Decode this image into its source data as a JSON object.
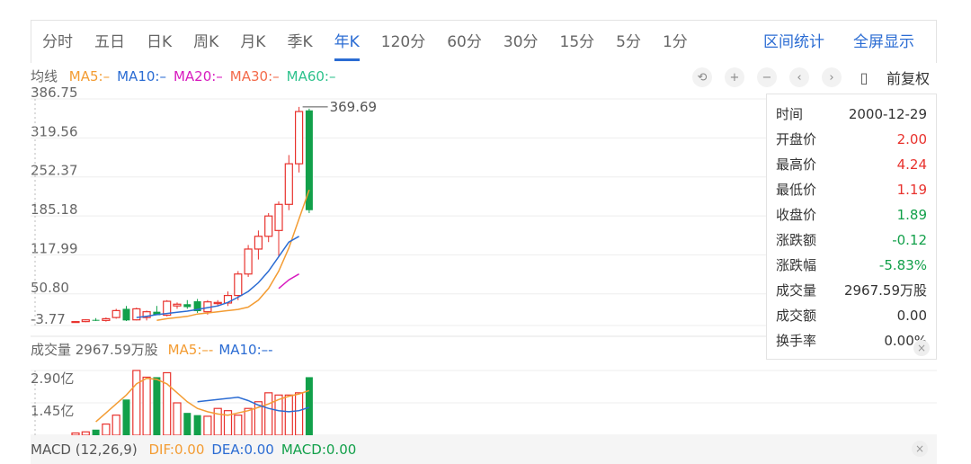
{
  "tabs": [
    "分时",
    "五日",
    "日K",
    "周K",
    "月K",
    "季K",
    "年K",
    "120分",
    "60分",
    "30分",
    "15分",
    "5分",
    "1分"
  ],
  "active_tab": "年K",
  "tab_actions": {
    "range_stats": "区间统计",
    "fullscreen": "全屏显示"
  },
  "ma_legend": {
    "title": "均线",
    "items": [
      {
        "label": "MA5:–",
        "color": "#f39c33"
      },
      {
        "label": "MA10:–",
        "color": "#2b6cd3"
      },
      {
        "label": "MA20:–",
        "color": "#d81bbf"
      },
      {
        "label": "MA30:–",
        "color": "#f36a4a"
      },
      {
        "label": "MA60:–",
        "color": "#2ec28d"
      }
    ]
  },
  "toolbar": {
    "icons": [
      "undo-icon",
      "zoom-in-icon",
      "zoom-out-icon",
      "chevron-left-icon",
      "chevron-right-icon",
      "candlestick-icon"
    ],
    "adjust_label": "前复权"
  },
  "info_panel": {
    "rows": [
      {
        "label": "时间",
        "value": "2000-12-29",
        "color": "#333333"
      },
      {
        "label": "开盘价",
        "value": "2.00",
        "color": "#e8322d"
      },
      {
        "label": "最高价",
        "value": "4.24",
        "color": "#e8322d"
      },
      {
        "label": "最低价",
        "value": "1.19",
        "color": "#e8322d"
      },
      {
        "label": "收盘价",
        "value": "1.89",
        "color": "#12a04a"
      },
      {
        "label": "涨跌额",
        "value": "-0.12",
        "color": "#12a04a"
      },
      {
        "label": "涨跌幅",
        "value": "-5.83%",
        "color": "#12a04a"
      },
      {
        "label": "成交量",
        "value": "2967.59万股",
        "color": "#333333"
      },
      {
        "label": "成交额",
        "value": "0.00",
        "color": "#333333"
      },
      {
        "label": "换手率",
        "value": "0.00%",
        "color": "#333333"
      }
    ]
  },
  "volume_legend": {
    "title": "成交量 2967.59万股",
    "items": [
      {
        "label": "MA5:–-",
        "color": "#f39c33"
      },
      {
        "label": "MA10:–-",
        "color": "#2b6cd3"
      }
    ]
  },
  "macd_legend": {
    "title": "MACD (12,26,9)",
    "items": [
      {
        "label": "DIF:0.00",
        "color": "#f39c33"
      },
      {
        "label": "DEA:0.00",
        "color": "#2b6cd3"
      },
      {
        "label": "MACD:0.00",
        "color": "#12a04a"
      }
    ]
  },
  "colors": {
    "up": "#e8322d",
    "down": "#12a04a",
    "grid": "#eeeeee",
    "accent": "#2b6cd3"
  },
  "chart_data": [
    {
      "type": "candlestick",
      "y_ticks": [
        "386.75",
        "319.56",
        "252.37",
        "185.18",
        "117.99",
        "50.80",
        "-3.77"
      ],
      "ylim": [
        -3.77,
        386.75
      ],
      "max_label": "369.69",
      "candles": [
        {
          "o": 2,
          "h": 4,
          "l": 1,
          "c": 3
        },
        {
          "o": 3,
          "h": 7,
          "l": 2,
          "c": 6
        },
        {
          "o": 6,
          "h": 9,
          "l": 4,
          "c": 5
        },
        {
          "o": 5,
          "h": 10,
          "l": 3,
          "c": 8
        },
        {
          "o": 10,
          "h": 25,
          "l": 8,
          "c": 22
        },
        {
          "o": 25,
          "h": 30,
          "l": 4,
          "c": 5
        },
        {
          "o": 6,
          "h": 27,
          "l": 5,
          "c": 25
        },
        {
          "o": 10,
          "h": 22,
          "l": 5,
          "c": 20
        },
        {
          "o": 20,
          "h": 30,
          "l": 16,
          "c": 14
        },
        {
          "o": 14,
          "h": 40,
          "l": 12,
          "c": 38
        },
        {
          "o": 30,
          "h": 36,
          "l": 25,
          "c": 33
        },
        {
          "o": 33,
          "h": 40,
          "l": 25,
          "c": 28
        },
        {
          "o": 38,
          "h": 42,
          "l": 18,
          "c": 21
        },
        {
          "o": 20,
          "h": 40,
          "l": 15,
          "c": 37
        },
        {
          "o": 34,
          "h": 40,
          "l": 30,
          "c": 36
        },
        {
          "o": 35,
          "h": 55,
          "l": 30,
          "c": 48
        },
        {
          "o": 48,
          "h": 90,
          "l": 40,
          "c": 85
        },
        {
          "o": 85,
          "h": 135,
          "l": 80,
          "c": 128
        },
        {
          "o": 128,
          "h": 160,
          "l": 110,
          "c": 150
        },
        {
          "o": 150,
          "h": 190,
          "l": 140,
          "c": 185
        },
        {
          "o": 160,
          "h": 210,
          "l": 115,
          "c": 205
        },
        {
          "o": 205,
          "h": 290,
          "l": 195,
          "c": 275
        },
        {
          "o": 275,
          "h": 373,
          "l": 260,
          "c": 365
        },
        {
          "o": 367,
          "h": 370,
          "l": 190,
          "c": 195
        }
      ],
      "ma5": [
        5,
        8,
        10,
        12,
        16,
        18,
        20,
        22,
        24,
        28,
        40,
        60,
        90,
        130,
        180,
        230
      ],
      "ma10": [
        10,
        12,
        15,
        17,
        19,
        21,
        24,
        27,
        30,
        36,
        45,
        55,
        70,
        90,
        115,
        140,
        150
      ],
      "ma20": [
        60,
        75,
        85
      ]
    },
    {
      "type": "bar",
      "y_ticks": [
        "2.90亿",
        "1.45亿",
        "0.00"
      ],
      "ylim": [
        0,
        2.9
      ],
      "volumes": [
        0.1,
        0.15,
        0.25,
        0.5,
        0.9,
        1.6,
        2.9,
        2.6,
        2.6,
        2.8,
        1.45,
        1.0,
        0.9,
        0.85,
        1.2,
        1.1,
        0.9,
        1.2,
        1.5,
        1.9,
        1.8,
        1.8,
        1.9,
        2.6
      ],
      "vol_ma5": [
        0.6,
        1.0,
        1.4,
        1.8,
        2.3,
        2.55,
        2.5,
        2.3,
        1.9,
        1.5,
        1.2,
        1.05,
        0.95,
        0.9,
        1.0,
        1.1,
        1.25,
        1.4,
        1.6,
        1.75,
        1.85,
        2.0
      ],
      "vol_ma10": [
        1.5,
        1.55,
        1.6,
        1.65,
        1.7,
        1.55,
        1.35,
        1.2,
        1.1,
        1.05,
        1.1,
        1.25
      ]
    }
  ]
}
